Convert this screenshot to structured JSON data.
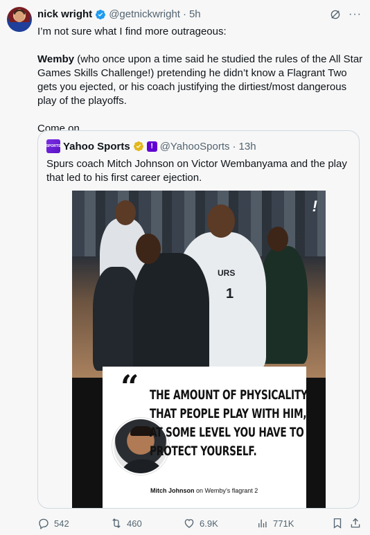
{
  "author": {
    "name": "nick wright",
    "handle": "@getnickwright",
    "separator": "·",
    "time": "5h"
  },
  "tweet": {
    "line1": "I’m not sure what I find more outrageous:",
    "p2_bold": "Wemby",
    "p2_rest": " (who once upon a time said he studied the rules of the All Star Games Skills Challenge!) pretending he didn’t know a Flagrant Two gets you ejected, or his coach justifying the dirtiest/most dangerous play of the playoffs.",
    "p3": "Come on."
  },
  "quoted": {
    "avatar_text": "SPORTS",
    "name": "Yahoo Sports",
    "badge_letter": "!",
    "handle": "@YahooSports",
    "separator": "·",
    "time": "13h",
    "text": "Spurs coach Mitch Johnson on Victor Wembanyama and the play that led to his first career ejection.",
    "media": {
      "jersey_text": "URS",
      "jersey_number": "1",
      "corner_mark": "!",
      "quote_mark": "“",
      "quote_lines": [
        "THE AMOUNT OF PHYSICALITY",
        "THAT PEOPLE PLAY WITH HIM,",
        "AT SOME LEVEL YOU HAVE TO",
        "PROTECT YOURSELF."
      ],
      "attribution_name": "Mitch Johnson",
      "attribution_rest": " on Wemby’s flagrant 2"
    }
  },
  "actions": {
    "replies": "542",
    "retweets": "460",
    "likes": "6.9K",
    "views": "771K"
  },
  "colors": {
    "verified_blue": "#1d9bf0",
    "gold_badge": "#e2b719",
    "yahoo_purple": "#6001d2",
    "secondary_text": "#536471"
  }
}
